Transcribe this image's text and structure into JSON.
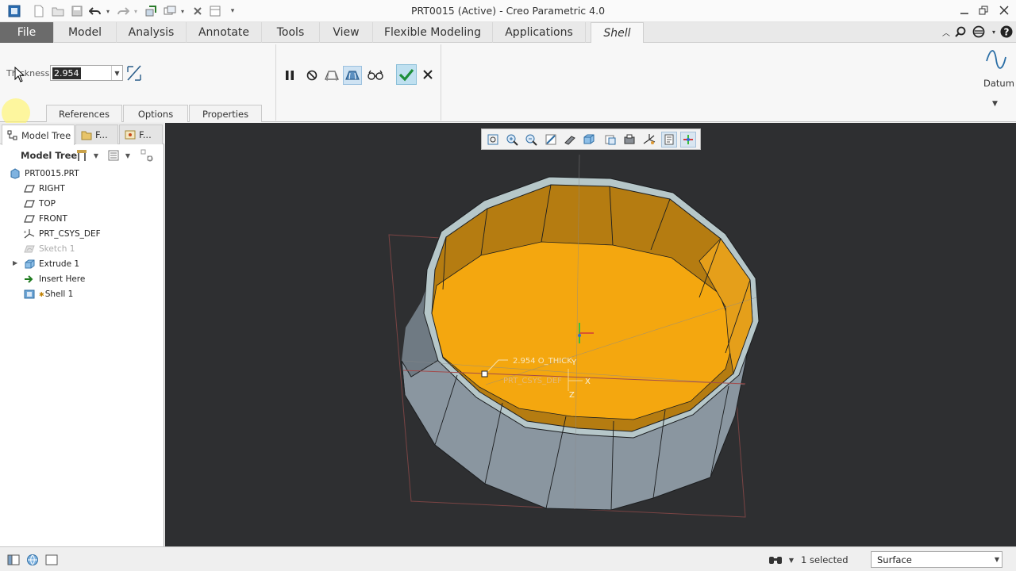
{
  "window": {
    "title": "PRT0015 (Active) - Creo Parametric 4.0",
    "minimize_icon": "minimize-icon",
    "restore_icon": "restore-icon",
    "close_icon": "close-icon"
  },
  "quick_access": [
    "window-icon",
    "new-icon",
    "open-icon",
    "save-icon",
    "undo-icon",
    "redo-icon",
    "regenerate-icon",
    "windows-icon",
    "close-window-icon",
    "customize-icon"
  ],
  "ribbon": {
    "tabs": [
      {
        "label": "File"
      },
      {
        "label": "Model"
      },
      {
        "label": "Analysis"
      },
      {
        "label": "Annotate"
      },
      {
        "label": "Tools"
      },
      {
        "label": "View"
      },
      {
        "label": "Flexible Modeling"
      },
      {
        "label": "Applications"
      },
      {
        "label": "Shell"
      }
    ],
    "active_tab": "Shell"
  },
  "dashboard": {
    "thickness_label": "Thickness",
    "thickness_value": "2.954",
    "slide_tabs": [
      "References",
      "Options",
      "Properties"
    ],
    "datum_label": "Datum"
  },
  "model_tree": {
    "tabs": [
      "Model Tree",
      "F...",
      "F..."
    ],
    "title": "Model Tree",
    "items": [
      {
        "label": "PRT0015.PRT",
        "icon": "part-icon"
      },
      {
        "label": "RIGHT",
        "icon": "datum-plane-icon"
      },
      {
        "label": "TOP",
        "icon": "datum-plane-icon"
      },
      {
        "label": "FRONT",
        "icon": "datum-plane-icon"
      },
      {
        "label": "PRT_CSYS_DEF",
        "icon": "csys-icon"
      },
      {
        "label": "Sketch 1",
        "icon": "sketch-icon"
      },
      {
        "label": "Extrude 1",
        "icon": "extrude-icon"
      },
      {
        "label": "Insert Here",
        "icon": "insert-arrow-icon"
      },
      {
        "label": "Shell 1",
        "icon": "shell-icon"
      }
    ]
  },
  "viewport": {
    "dimension_label": "2.954 O_THICK",
    "csys_label": "PRT_CSYS_DEF",
    "axis_x": "X",
    "axis_y": "Y",
    "axis_z": "Z",
    "colors": {
      "background": "#2e2f31",
      "inner_surface": "#f4a70f",
      "outer_surface": "#8e9aa4"
    }
  },
  "status_bar": {
    "selection": "1 selected",
    "filter": "Surface"
  }
}
